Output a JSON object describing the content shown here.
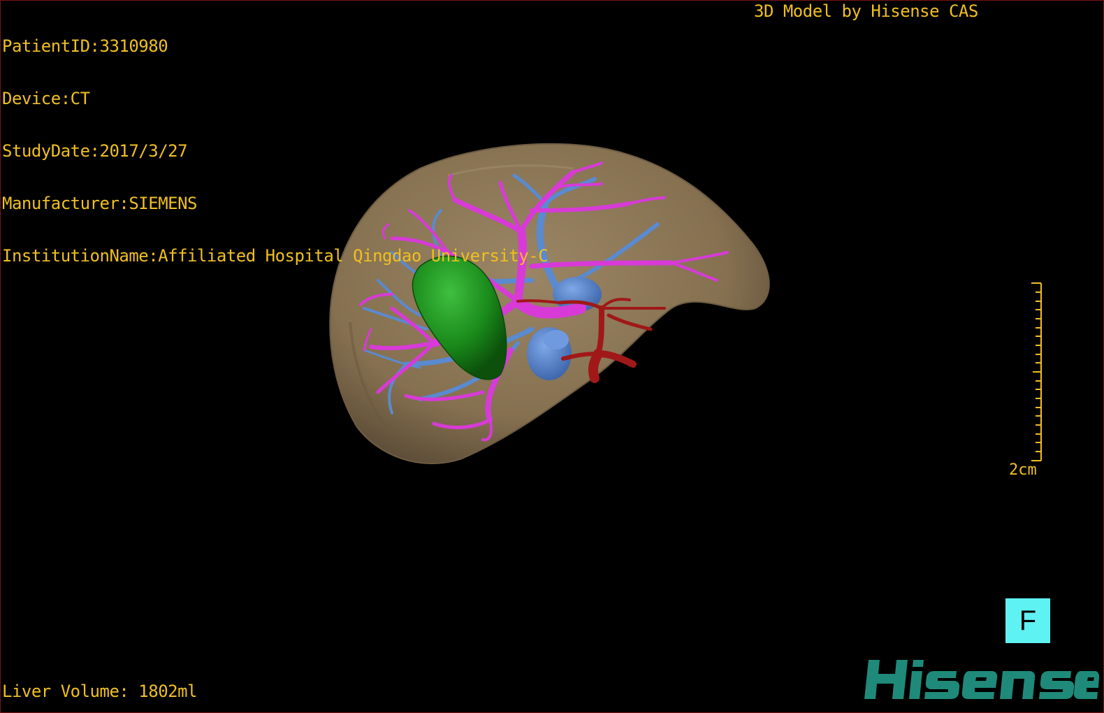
{
  "dicom_info": {
    "patient_id": "PatientID:3310980",
    "device": "Device:CT",
    "study_date": "StudyDate:2017/3/27",
    "manufacturer": "Manufacturer:SIEMENS",
    "institution": "InstitutionName:Affiliated Hospital Qingdao University-C"
  },
  "header": {
    "model_credit": "3D Model by Hisense CAS"
  },
  "footer": {
    "liver_volume": "Liver Volume: 1802ml"
  },
  "scale": {
    "label": "2cm"
  },
  "orientation": {
    "label": "F"
  },
  "brand": {
    "name": "Hisense",
    "color": "#1f8a7a"
  },
  "colors": {
    "overlay_text": "#f0c020",
    "liver": "#8a7456",
    "portal_vein": "#d83ad8",
    "hepatic_vein": "#5a8ad0",
    "artery": "#a01818",
    "gallbladder": "#1a8a1a",
    "orientation_cube": "#5ff2f2"
  }
}
